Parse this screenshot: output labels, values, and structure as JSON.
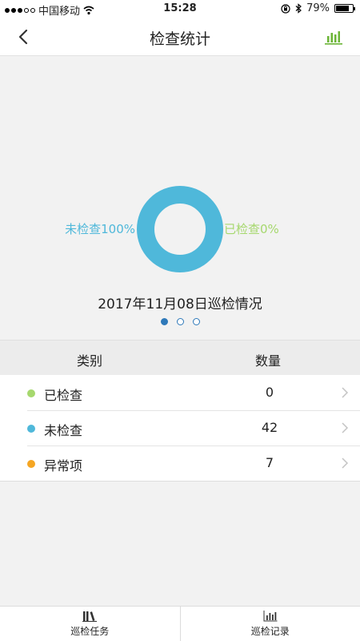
{
  "status_bar": {
    "carrier": "中国移动",
    "time": "15:28",
    "battery": "79%",
    "battery_level": 0.79
  },
  "header": {
    "title": "检查统计"
  },
  "chart_data": {
    "type": "pie",
    "style": "donut",
    "slices": [
      {
        "label": "未检查100%",
        "value": 100,
        "color": "#4fb8da"
      },
      {
        "label": "已检查0%",
        "value": 0,
        "color": "#a6d86e"
      }
    ],
    "caption": "2017年11月08日巡检情况"
  },
  "pager": {
    "count": 3,
    "active_index": 0
  },
  "table": {
    "headers": {
      "category": "类别",
      "quantity": "数量"
    },
    "rows": [
      {
        "label": "已检查",
        "count": "0",
        "color": "#a6d86e"
      },
      {
        "label": "未检查",
        "count": "42",
        "color": "#4fb8da"
      },
      {
        "label": "异常项",
        "count": "7",
        "color": "#f5a623"
      }
    ]
  },
  "tab_bar": {
    "tabs": [
      {
        "label": "巡检任务",
        "icon": "books-icon"
      },
      {
        "label": "巡检记录",
        "icon": "bar-chart-icon"
      }
    ]
  },
  "colors": {
    "accent_green": "#6bb536",
    "pager_blue": "#2e79b9"
  }
}
